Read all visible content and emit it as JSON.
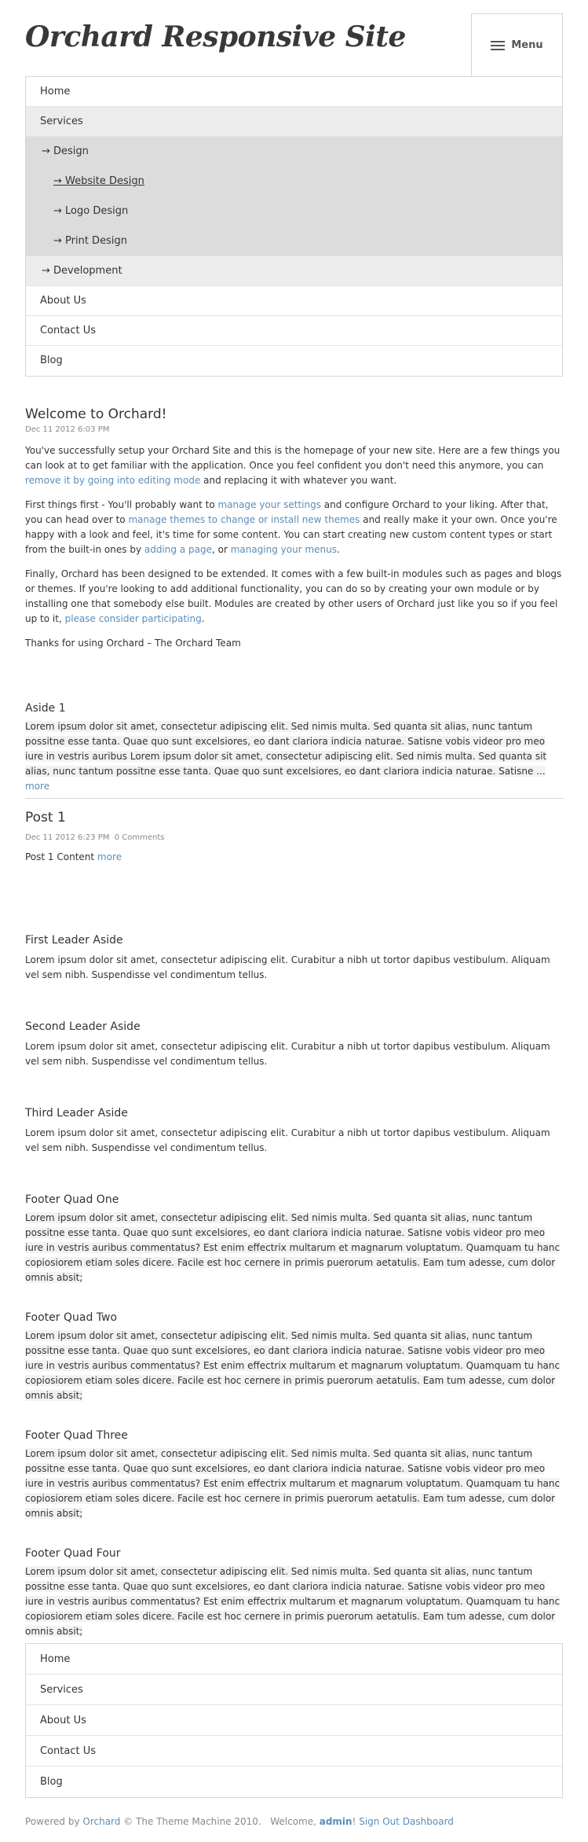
{
  "header": {
    "site_title": "Orchard Responsive Site",
    "menu_label": "Menu"
  },
  "top_nav": [
    {
      "label": "Home"
    },
    {
      "label": "Services"
    },
    {
      "label": "→ Design"
    },
    {
      "label": "→ Website Design"
    },
    {
      "label": "→ Logo Design"
    },
    {
      "label": "→ Print Design"
    },
    {
      "label": "→ Development"
    },
    {
      "label": "About Us"
    },
    {
      "label": "Contact Us"
    },
    {
      "label": "Blog"
    }
  ],
  "welcome": {
    "title": "Welcome to Orchard!",
    "date": "Dec 11 2012 6:03 PM",
    "p1_a": "You've successfully setup your Orchard Site and this is the homepage of your new site. Here are a few things you can look at to get familiar with the application. Once you feel confident you don't need this anymore, you can ",
    "p1_link": "remove it by going into editing mode",
    "p1_b": " and replacing it with whatever you want.",
    "p2_a": "First things first - You'll probably want to ",
    "p2_link1": "manage your settings",
    "p2_b": " and configure Orchard to your liking. After that, you can head over to ",
    "p2_link2": "manage themes to change or install new themes",
    "p2_c": " and really make it your own. Once you're happy with a look and feel, it's time for some content. You can start creating new custom content types or start from the built-in ones by ",
    "p2_link3": "adding a page",
    "p2_d": ", or ",
    "p2_link4": "managing your menus",
    "p2_e": ".",
    "p3_a": "Finally, Orchard has been designed to be extended. It comes with a few built-in modules such as pages and blogs or themes. If you're looking to add additional functionality, you can do so by creating your own module or by installing one that somebody else built. Modules are created by other users of Orchard just like you so if you feel up to it, ",
    "p3_link": "please consider participating",
    "p3_b": ".",
    "p4": "Thanks for using Orchard – The Orchard Team"
  },
  "aside1": {
    "title": "Aside 1",
    "text": "Lorem ipsum dolor sit amet, consectetur adipiscing elit. Sed nimis multa. Sed quanta sit alias, nunc tantum possitne esse tanta. Quae quo sunt excelsiores, eo dant clariora indicia naturae. Satisne vobis videor pro meo iure in vestris auribus Lorem ipsum dolor sit amet, consectetur adipiscing elit. Sed nimis multa. Sed quanta sit alias, nunc tantum possitne esse tanta. Quae quo sunt excelsiores, eo dant clariora indicia naturae. Satisne ... ",
    "more": "more"
  },
  "post1": {
    "title": "Post 1",
    "date": "Dec 11 2012 6:23 PM",
    "comments": "0 Comments",
    "content": "Post 1 Content ",
    "more": "more"
  },
  "leaders": [
    {
      "title": "First Leader Aside",
      "text": "Lorem ipsum dolor sit amet, consectetur adipiscing elit. Curabitur a nibh ut tortor dapibus vestibulum. Aliquam vel sem nibh. Suspendisse vel condimentum tellus."
    },
    {
      "title": "Second Leader Aside",
      "text": "Lorem ipsum dolor sit amet, consectetur adipiscing elit. Curabitur a nibh ut tortor dapibus vestibulum. Aliquam vel sem nibh. Suspendisse vel condimentum tellus."
    },
    {
      "title": "Third Leader Aside",
      "text": "Lorem ipsum dolor sit amet, consectetur adipiscing elit. Curabitur a nibh ut tortor dapibus vestibulum. Aliquam vel sem nibh. Suspendisse vel condimentum tellus."
    }
  ],
  "footer_quads": [
    {
      "title": "Footer Quad One",
      "text": "Lorem ipsum dolor sit amet, consectetur adipiscing elit. Sed nimis multa. Sed quanta sit alias, nunc tantum possitne esse tanta. Quae quo sunt excelsiores, eo dant clariora indicia naturae. Satisne vobis videor pro meo iure in vestris auribus commentatus? Est enim effectrix multarum et magnarum voluptatum. Quamquam tu hanc copiosiorem etiam soles dicere. Facile est hoc cernere in primis puerorum aetatulis. Eam tum adesse, cum dolor omnis absit;"
    },
    {
      "title": "Footer Quad Two",
      "text": "Lorem ipsum dolor sit amet, consectetur adipiscing elit. Sed nimis multa. Sed quanta sit alias, nunc tantum possitne esse tanta. Quae quo sunt excelsiores, eo dant clariora indicia naturae. Satisne vobis videor pro meo iure in vestris auribus commentatus? Est enim effectrix multarum et magnarum voluptatum. Quamquam tu hanc copiosiorem etiam soles dicere. Facile est hoc cernere in primis puerorum aetatulis. Eam tum adesse, cum dolor omnis absit;"
    },
    {
      "title": "Footer Quad Three",
      "text": "Lorem ipsum dolor sit amet, consectetur adipiscing elit. Sed nimis multa. Sed quanta sit alias, nunc tantum possitne esse tanta. Quae quo sunt excelsiores, eo dant clariora indicia naturae. Satisne vobis videor pro meo iure in vestris auribus commentatus? Est enim effectrix multarum et magnarum voluptatum. Quamquam tu hanc copiosiorem etiam soles dicere. Facile est hoc cernere in primis puerorum aetatulis. Eam tum adesse, cum dolor omnis absit;"
    },
    {
      "title": "Footer Quad Four",
      "text": "Lorem ipsum dolor sit amet, consectetur adipiscing elit. Sed nimis multa. Sed quanta sit alias, nunc tantum possitne esse tanta. Quae quo sunt excelsiores, eo dant clariora indicia naturae. Satisne vobis videor pro meo iure in vestris auribus commentatus? Est enim effectrix multarum et magnarum voluptatum. Quamquam tu hanc copiosiorem etiam soles dicere. Facile est hoc cernere in primis puerorum aetatulis. Eam tum adesse, cum dolor omnis absit;"
    }
  ],
  "bottom_nav": [
    {
      "label": "Home"
    },
    {
      "label": "Services"
    },
    {
      "label": "About Us"
    },
    {
      "label": "Contact Us"
    },
    {
      "label": "Blog"
    }
  ],
  "footer": {
    "powered_by": "Powered by ",
    "orchard_link": "Orchard",
    "copyright": " © The Theme Machine 2010.",
    "welcome": "   Welcome, ",
    "user": "admin",
    "excl": "!",
    "sign_out": "Sign Out",
    "dashboard": "Dashboard"
  },
  "colors": {
    "link": "#5b8db8",
    "text": "#333333",
    "nav_gray": "#ececec",
    "nav_dark": "#dcdcdc"
  }
}
